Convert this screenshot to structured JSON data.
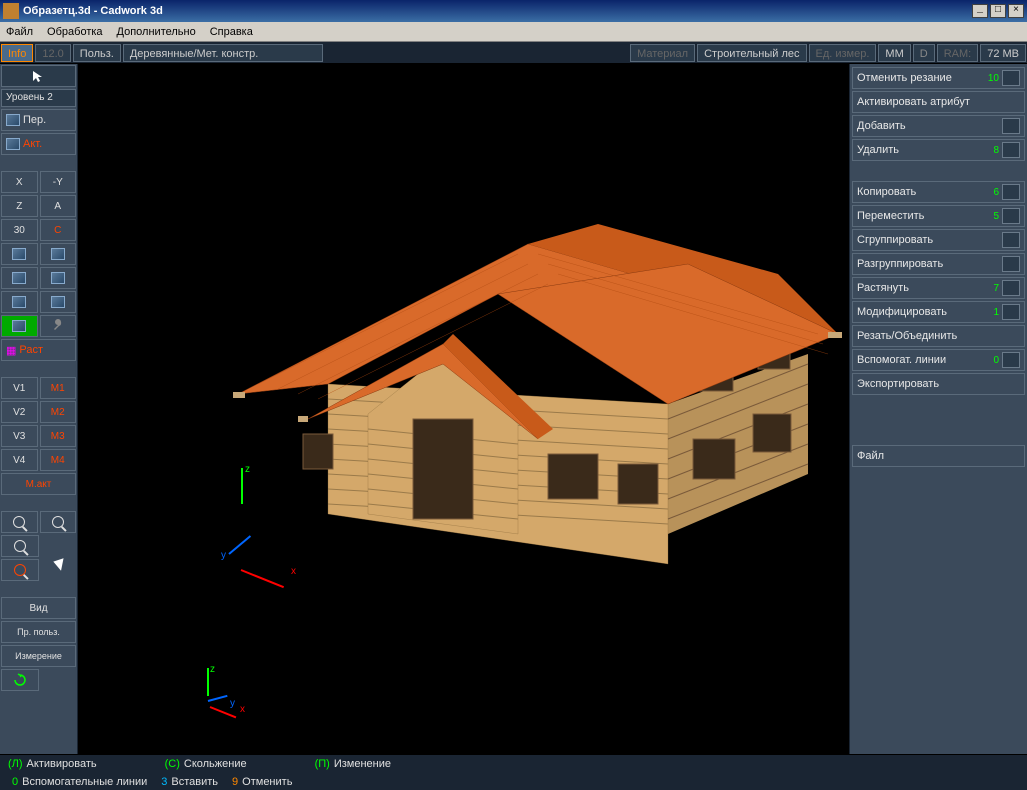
{
  "title": "Образетц.3d - Cadwork 3d",
  "menubar": [
    "Файл",
    "Обработка",
    "Дополнительно",
    "Справка"
  ],
  "infobar": {
    "info": "Info",
    "ver": "12.0",
    "user": "Польз.",
    "type": "Деревянные/Мет. констр.",
    "material_lbl": "Материал",
    "material": "Строительный лес",
    "unit_lbl": "Ед. измер.",
    "unit": "MM",
    "d": "D",
    "ram": "RAM:",
    "mem": "72 MB"
  },
  "left": {
    "level": "Уровень 2",
    "per": "Пер.",
    "akt": "Акт.",
    "axes": {
      "x": "X",
      "ny": "-Y",
      "z": "Z",
      "a": "A",
      "n30": "30",
      "c": "C"
    },
    "rast": "Раст",
    "v": [
      "V1",
      "V2",
      "V3",
      "V4"
    ],
    "m": [
      "M1",
      "M2",
      "M3",
      "M4"
    ],
    "mact": "М.акт",
    "vid": "Вид",
    "pr": "Пр. польз.",
    "izm": "Измерение"
  },
  "right": {
    "undo": {
      "label": "Отменить резание",
      "cnt": "10"
    },
    "attr": {
      "label": "Активировать атрибут"
    },
    "add": {
      "label": "Добавить"
    },
    "del": {
      "label": "Удалить",
      "cnt": "8"
    },
    "copy": {
      "label": "Копировать",
      "cnt": "6"
    },
    "move": {
      "label": "Переместить",
      "cnt": "5"
    },
    "group": {
      "label": "Сгруппировать"
    },
    "ungroup": {
      "label": "Разгруппировать"
    },
    "stretch": {
      "label": "Растянуть",
      "cnt": "7"
    },
    "modify": {
      "label": "Модифицировать",
      "cnt": "1"
    },
    "cut": {
      "label": "Резать/Объединить"
    },
    "aux": {
      "label": "Вспомогат. линии",
      "cnt": "0"
    },
    "export": {
      "label": "Экспортировать"
    },
    "file": {
      "label": "Файл"
    }
  },
  "status": {
    "l": "(Л)",
    "l_t": "Активировать",
    "c": "(С)",
    "c_t": "Скольжение",
    "p": "(П)",
    "p_t": "Изменение",
    "k0": "0",
    "t0": "Вспомогательные линии",
    "k3": "3",
    "t3": "Вставить",
    "k9": "9",
    "t9": "Отменить"
  },
  "axis": {
    "x": "x",
    "y": "y",
    "z": "z"
  }
}
